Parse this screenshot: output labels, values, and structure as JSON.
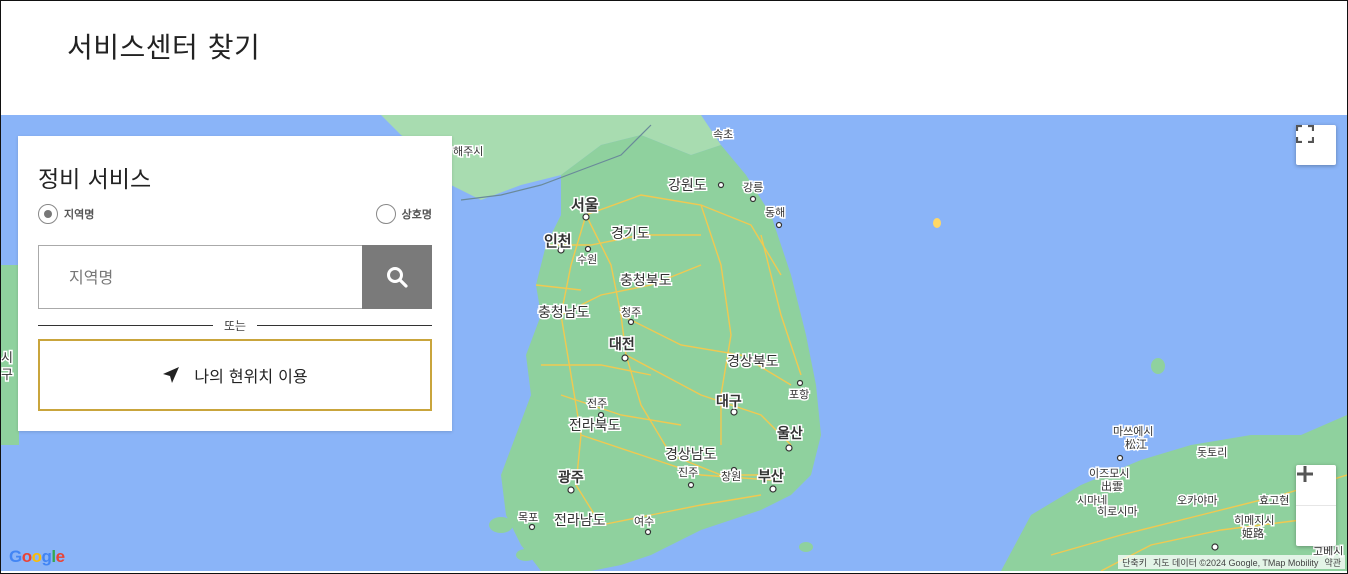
{
  "page": {
    "title": "서비스센터 찾기"
  },
  "panel": {
    "title": "정비 서비스",
    "radio_region": "지역명",
    "radio_shop": "상호명",
    "search_placeholder": "지역명",
    "divider_text": "또는",
    "locate_label": "나의 현위치 이용"
  },
  "map": {
    "labels": {
      "haeju": "해주시",
      "sokcho": "속초",
      "seoul": "서울",
      "gangwon": "강원도",
      "gangneung": "강릉",
      "donghae": "동해",
      "incheon": "인천",
      "gyeonggi": "경기도",
      "suwon": "수원",
      "chungbuk": "충청북도",
      "chungnam": "충청남도",
      "cheongju": "청주",
      "daejeon": "대전",
      "gyeongbuk": "경상북도",
      "pohang": "포항",
      "jeonju": "전주",
      "daegu": "대구",
      "jeonbuk": "전라북도",
      "ulsan": "울산",
      "gyeongnam": "경상남도",
      "gwangju": "광주",
      "jinju": "진주",
      "changwon": "창원",
      "busan": "부산",
      "mokpo": "목포",
      "jeonnam": "전라남도",
      "yeosu": "여수",
      "matsue_kr": "마쓰에시",
      "matsue_jp": "松江",
      "tottori": "돗토리",
      "izumo_kr": "이즈모시",
      "izumo_jp": "出雲",
      "himeji_kr": "히메지시",
      "himeji_jp": "姫路",
      "shimane": "시마네",
      "hiroshima": "히로시마",
      "kobe": "고베시",
      "okayama": "오카야마",
      "hyogo": "효고현",
      "left_edge_1": "시",
      "left_edge_2": "구"
    },
    "google_logo": "Google",
    "attribution": [
      "단축키",
      "지도 데이터 ©2024 Google, TMap Mobility",
      "약관"
    ]
  },
  "colors": {
    "accent": "#c9a53c",
    "search_button": "#7a7a7a",
    "sea": "#8ab4f8",
    "land": "#8fd19e"
  },
  "icons": {
    "search": "search-icon",
    "locate": "navigation-arrow-icon",
    "fullscreen": "fullscreen-icon",
    "zoom_in": "plus-icon",
    "zoom_out": "minus-icon"
  }
}
